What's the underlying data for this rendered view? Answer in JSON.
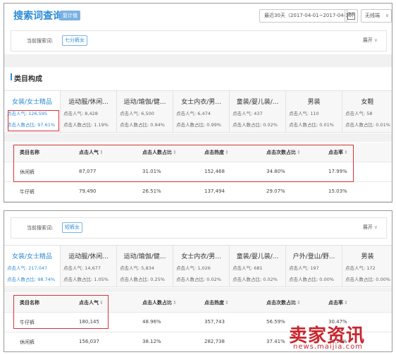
{
  "header": {
    "title": "搜索词查询",
    "tag": "复计值",
    "date_range": "最近30天（2017-04-01~2017-04-30）",
    "terminal": "无线端"
  },
  "search1": {
    "label": "当前搜索词:",
    "word": "七分裤女",
    "expand": "展开"
  },
  "search2": {
    "label": "当前搜索词:",
    "word": "短裤女",
    "expand": "展开"
  },
  "section_title": "类目构成",
  "cats1": [
    {
      "name": "女装/女士精品",
      "m1": "点击人气: 126,595",
      "m2": "点击人数占比: 97.61%"
    },
    {
      "name": "运动服/休闲...",
      "m1": "点击人气: 8,428",
      "m2": "点击人数占比: 1.19%"
    },
    {
      "name": "运动/瑜伽/健...",
      "m1": "点击人气: 6,500",
      "m2": "点击人数占比: 0.94%"
    },
    {
      "name": "女士内衣/男...",
      "m1": "点击人气: 6,474",
      "m2": "点击人数占比: 0.99%"
    },
    {
      "name": "童装/婴儿装/...",
      "m1": "点击人气: 437",
      "m2": "点击人数占比: 0.02%"
    },
    {
      "name": "男装",
      "m1": "点击人气: 110",
      "m2": "点击人数占比: 0.01%"
    },
    {
      "name": "女鞋",
      "m1": "点击人气: 58",
      "m2": "点击人数占比: 0.01%"
    }
  ],
  "cats2": [
    {
      "name": "女装/女士精品",
      "m1": "点击人气: 217,047",
      "m2": "点击人数占比: 98.74%"
    },
    {
      "name": "运动服/休闲...",
      "m1": "点击人气: 14,677",
      "m2": "点击人数占比: 1.05%"
    },
    {
      "name": "运动/瑜伽/健...",
      "m1": "点击人气: 5,834",
      "m2": "点击人数占比: 0.25%"
    },
    {
      "name": "女士内衣/男...",
      "m1": "点击人气: 1,026",
      "m2": "点击人数占比: 0.02%"
    },
    {
      "name": "童装/婴儿装/...",
      "m1": "点击人气: 681",
      "m2": "点击人数占比: 0.02%"
    },
    {
      "name": "户外/登山/野...",
      "m1": "点击人气: 197",
      "m2": "点击人数占比: 0.00%"
    },
    {
      "name": "男装",
      "m1": "点击人气: 172",
      "m2": "点击人数占比: 0.00%"
    }
  ],
  "table_headers": [
    "类目名称",
    "点击人气",
    "点击人数占比",
    "点击热度",
    "点击次数占比",
    "点击率"
  ],
  "sort_icon": "⇕",
  "rows1": [
    [
      "休闲裤",
      "87,077",
      "31.01%",
      "152,468",
      "34.80%",
      "17.99%"
    ],
    [
      "牛仔裤",
      "79,490",
      "26.51%",
      "137,494",
      "29.07%",
      "15.03%"
    ]
  ],
  "rows2": [
    [
      "牛仔裤",
      "180,145",
      "48.96%",
      "357,743",
      "56.59%",
      "30.47%"
    ],
    [
      "休闲裤",
      "156,037",
      "38.12%",
      "282,738",
      "37.41%",
      "26.18%"
    ]
  ],
  "watermark": {
    "main": "卖家资讯",
    "sub": "news.maijia.com"
  },
  "colors": {
    "accent": "#2c8cd6",
    "highlight": "#d9333a",
    "watermark": "#c8262e"
  }
}
